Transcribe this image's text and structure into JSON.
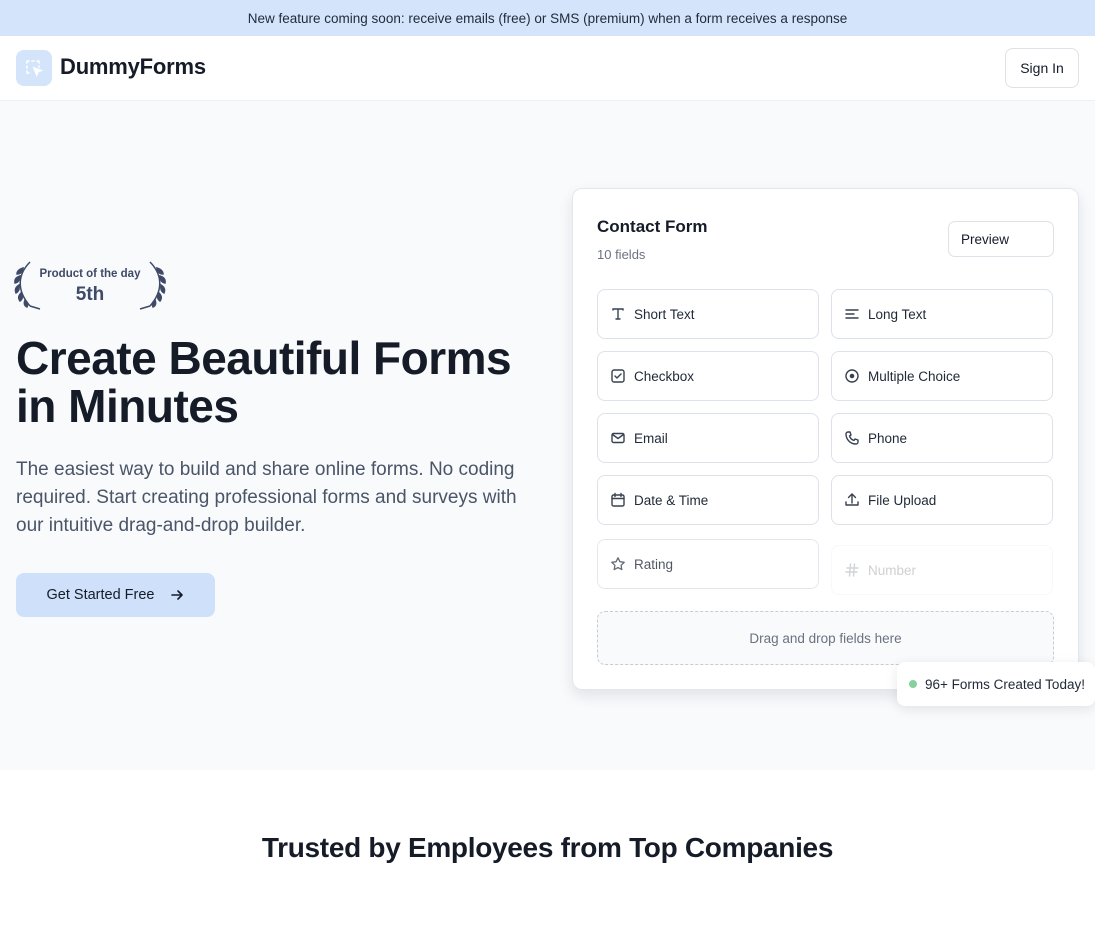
{
  "announcement": "New feature coming soon: receive emails (free) or SMS (premium) when a form receives a response",
  "nav": {
    "logo_icon": "cursor-select-icon",
    "brand": "DummyForms",
    "signin_label": "Sign In"
  },
  "hero": {
    "award": {
      "title": "Product of the day",
      "rank": "5th"
    },
    "headline": "Create Beautiful Forms in Minutes",
    "subtext": "The easiest way to build and share online forms. No coding required. Start creating professional forms and surveys with our intuitive drag-and-drop builder.",
    "cta_label": "Get Started Free"
  },
  "form_card": {
    "title": "Contact Form",
    "field_count": "10 fields",
    "preview_label": "Preview",
    "fields": [
      {
        "label": "Short Text",
        "icon": "text-icon"
      },
      {
        "label": "Long Text",
        "icon": "align-left-icon"
      },
      {
        "label": "Checkbox",
        "icon": "checkbox-icon"
      },
      {
        "label": "Multiple Choice",
        "icon": "radio-icon"
      },
      {
        "label": "Email",
        "icon": "mail-icon"
      },
      {
        "label": "Phone",
        "icon": "phone-icon"
      },
      {
        "label": "Date & Time",
        "icon": "calendar-icon"
      },
      {
        "label": "File Upload",
        "icon": "upload-icon"
      },
      {
        "label": "Rating",
        "icon": "star-icon"
      },
      {
        "label": "Number",
        "icon": "hash-icon"
      }
    ],
    "dropzone_text": "Drag and drop fields here"
  },
  "toast": {
    "text": "96+ Forms Created Today!",
    "dot_color": "#86d19c"
  },
  "trusted_heading": "Trusted by Employees from Top Companies",
  "colors": {
    "accent": "#d4e5fb",
    "hero_bg": "#f8fafc",
    "text": "#151c28"
  }
}
